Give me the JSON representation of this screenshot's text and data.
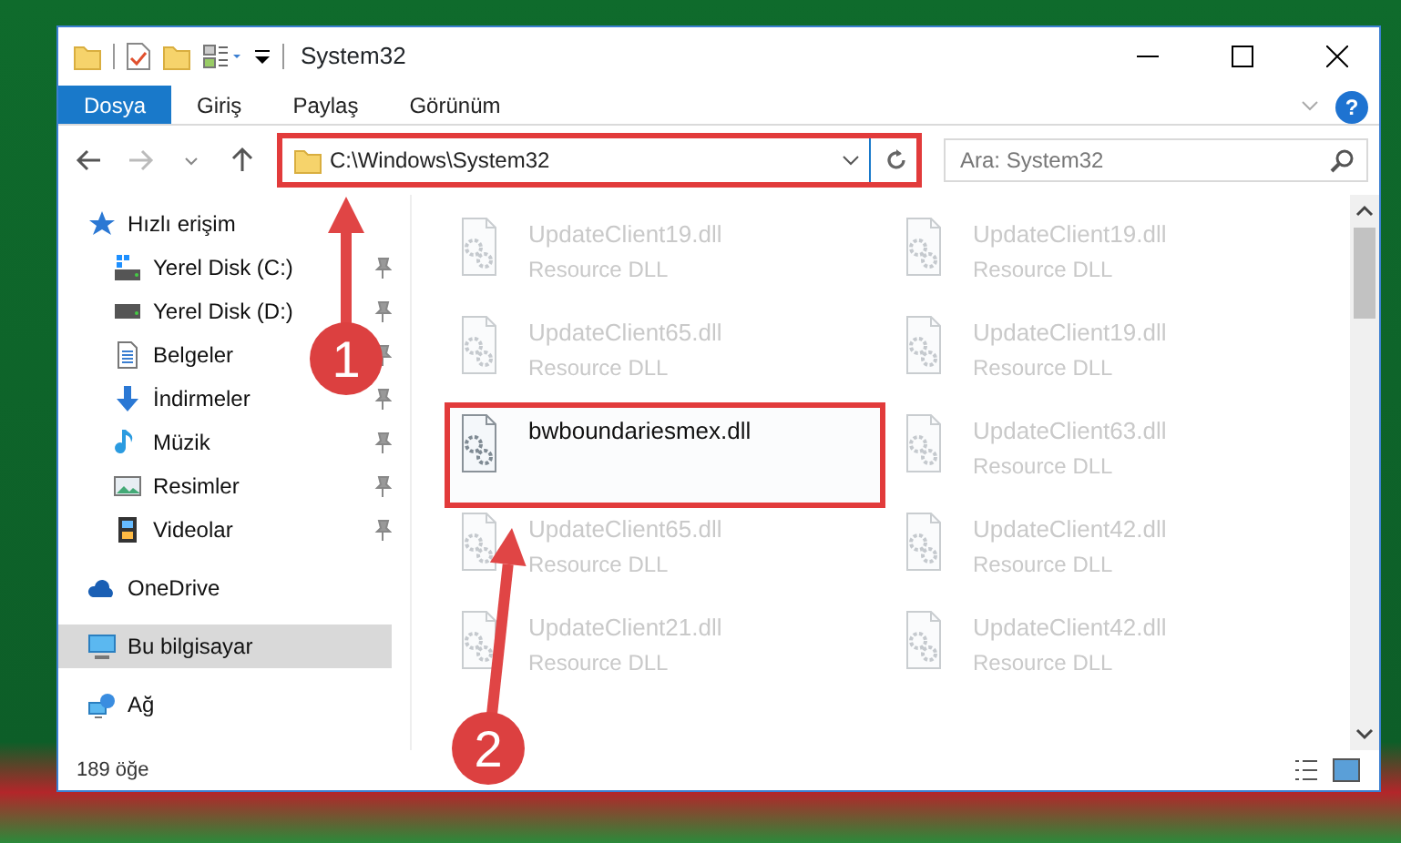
{
  "window": {
    "title": "System32"
  },
  "ribbon_tabs": [
    {
      "label": "Dosya",
      "selected": true
    },
    {
      "label": "Giriş",
      "selected": false
    },
    {
      "label": "Paylaş",
      "selected": false
    },
    {
      "label": "Görünüm",
      "selected": false
    }
  ],
  "address_bar": {
    "value": "C:\\Windows\\System32",
    "highlighted": true
  },
  "search": {
    "placeholder": "Ara: System32"
  },
  "sidebar": {
    "items": [
      {
        "label": "Hızlı erişim",
        "kind": "star",
        "pinned": false,
        "selected": false,
        "children": [
          {
            "label": "Yerel Disk (C:)",
            "kind": "system-drive",
            "pinned": true,
            "selected": false
          },
          {
            "label": "Yerel Disk (D:)",
            "kind": "drive",
            "pinned": true,
            "selected": false
          },
          {
            "label": "Belgeler",
            "kind": "documents",
            "pinned": true,
            "selected": false
          },
          {
            "label": "İndirmeler",
            "kind": "downloads",
            "pinned": true,
            "selected": false
          },
          {
            "label": "Müzik",
            "kind": "music",
            "pinned": true,
            "selected": false
          },
          {
            "label": "Resimler",
            "kind": "pictures",
            "pinned": true,
            "selected": false
          },
          {
            "label": "Videolar",
            "kind": "videos",
            "pinned": true,
            "selected": false
          }
        ]
      },
      {
        "label": "OneDrive",
        "kind": "cloud",
        "pinned": false,
        "selected": false
      },
      {
        "label": "Bu bilgisayar",
        "kind": "computer",
        "pinned": false,
        "selected": true
      },
      {
        "label": "Ağ",
        "kind": "network",
        "pinned": false,
        "selected": false
      }
    ]
  },
  "files": [
    {
      "name": "UpdateClient19.dll",
      "type": "Resource DLL",
      "blurred": true,
      "highlighted": false
    },
    {
      "name": "UpdateClient19.dll",
      "type": "Resource DLL",
      "blurred": true,
      "highlighted": false
    },
    {
      "name": "UpdateClient65.dll",
      "type": "Resource DLL",
      "blurred": true,
      "highlighted": false
    },
    {
      "name": "UpdateClient19.dll",
      "type": "Resource DLL",
      "blurred": true,
      "highlighted": false
    },
    {
      "name": "bwboundariesmex.dll",
      "blurred": false,
      "highlighted": true
    },
    {
      "name": "UpdateClient63.dll",
      "type": "Resource DLL",
      "blurred": true,
      "highlighted": false
    },
    {
      "name": "UpdateClient65.dll",
      "type": "Resource DLL",
      "blurred": true,
      "highlighted": false
    },
    {
      "name": "UpdateClient42.dll",
      "type": "Resource DLL",
      "blurred": true,
      "highlighted": false
    },
    {
      "name": "UpdateClient21.dll",
      "type": "Resource DLL",
      "blurred": true,
      "highlighted": false
    },
    {
      "name": "UpdateClient42.dll",
      "type": "Resource DLL",
      "blurred": true,
      "highlighted": false
    }
  ],
  "status_bar": {
    "item_count": "189 öğe"
  },
  "help_button": {
    "label": "?"
  },
  "annotations": [
    {
      "label": "1"
    },
    {
      "label": "2"
    }
  ]
}
